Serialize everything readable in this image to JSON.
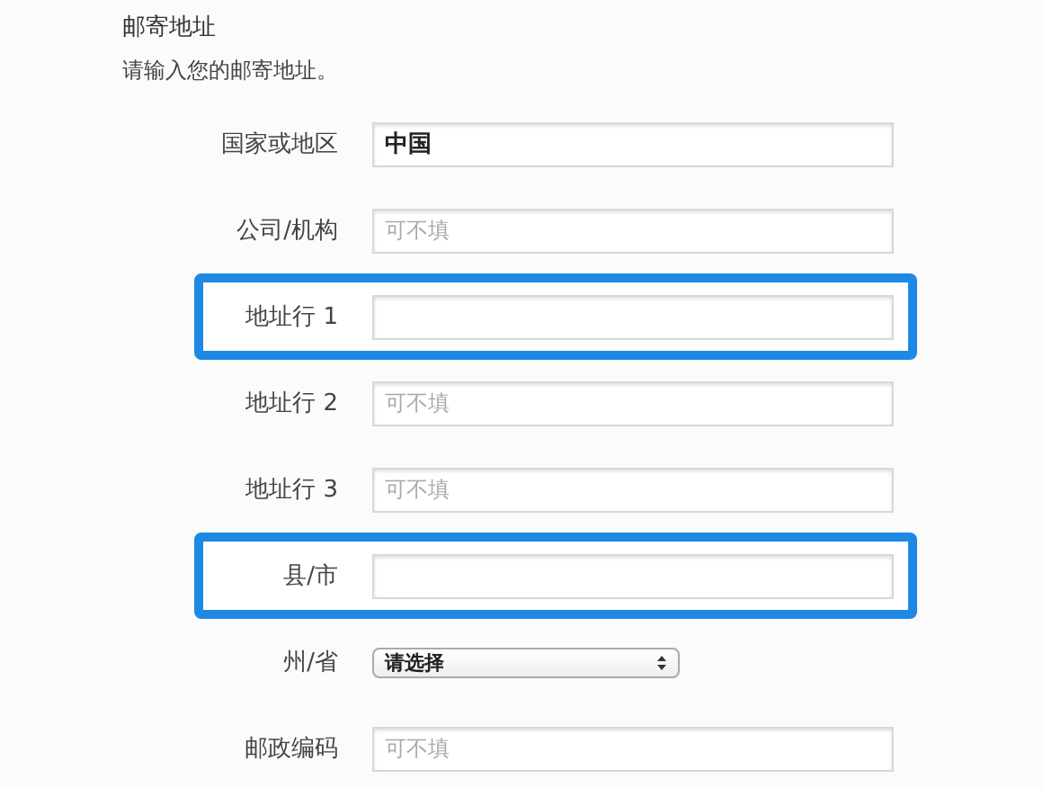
{
  "section": {
    "title": "邮寄地址",
    "subtitle": "请输入您的邮寄地址。"
  },
  "fields": [
    {
      "kind": "text",
      "label": "国家或地区",
      "value": "中国",
      "highlighted": false
    },
    {
      "kind": "text",
      "label": "公司/机构",
      "placeholder": "可不填",
      "highlighted": false
    },
    {
      "kind": "text",
      "label": "地址行 1",
      "highlighted": true
    },
    {
      "kind": "text",
      "label": "地址行 2",
      "placeholder": "可不填",
      "highlighted": false
    },
    {
      "kind": "text",
      "label": "地址行 3",
      "placeholder": "可不填",
      "highlighted": false
    },
    {
      "kind": "text",
      "label": "县/市",
      "highlighted": true
    },
    {
      "kind": "select",
      "label": "州/省",
      "value": "请选择",
      "highlighted": false
    },
    {
      "kind": "text",
      "label": "邮政编码",
      "placeholder": "可不填",
      "highlighted": false
    }
  ]
}
